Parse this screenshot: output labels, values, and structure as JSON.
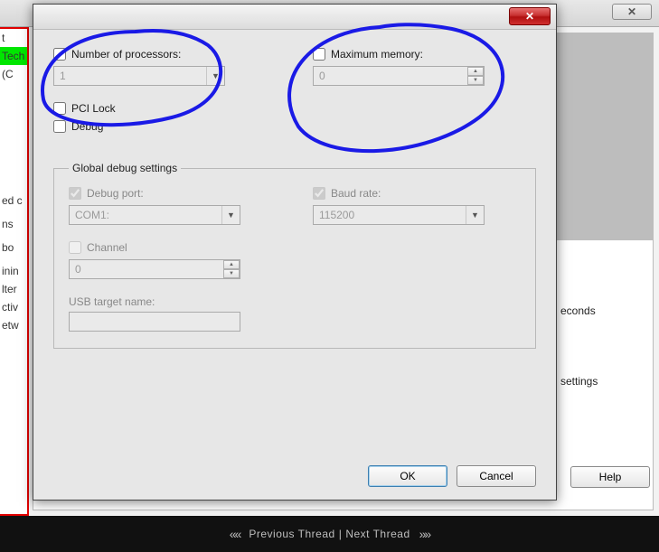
{
  "bg": {
    "close_glyph": "✕",
    "sidebar": [
      "t",
      "Tech",
      " (C",
      " ",
      " ",
      "ed c",
      " ",
      "ns",
      " ",
      " bo",
      " ",
      "inin",
      "lter",
      "ctiv",
      "etw"
    ],
    "right": {
      "seconds": "econds",
      "settings": "settings"
    },
    "help": "Help"
  },
  "dialog": {
    "close_glyph": "✕",
    "processors": {
      "label": "Number of processors:",
      "value": "1"
    },
    "memory": {
      "label": "Maximum memory:",
      "value": "0"
    },
    "pcilock": "PCI Lock",
    "debug": "Debug",
    "groupbox": "Global debug settings",
    "debugport": {
      "label": "Debug port:",
      "value": "COM1:"
    },
    "baudrate": {
      "label": "Baud rate:",
      "value": "115200"
    },
    "channel": {
      "label": "Channel",
      "value": "0"
    },
    "usbtarget": {
      "label": "USB target name:",
      "value": ""
    },
    "ok": "OK",
    "cancel": "Cancel"
  },
  "footer": {
    "prev": "Previous Thread",
    "sep": "|",
    "next": "Next Thread"
  }
}
